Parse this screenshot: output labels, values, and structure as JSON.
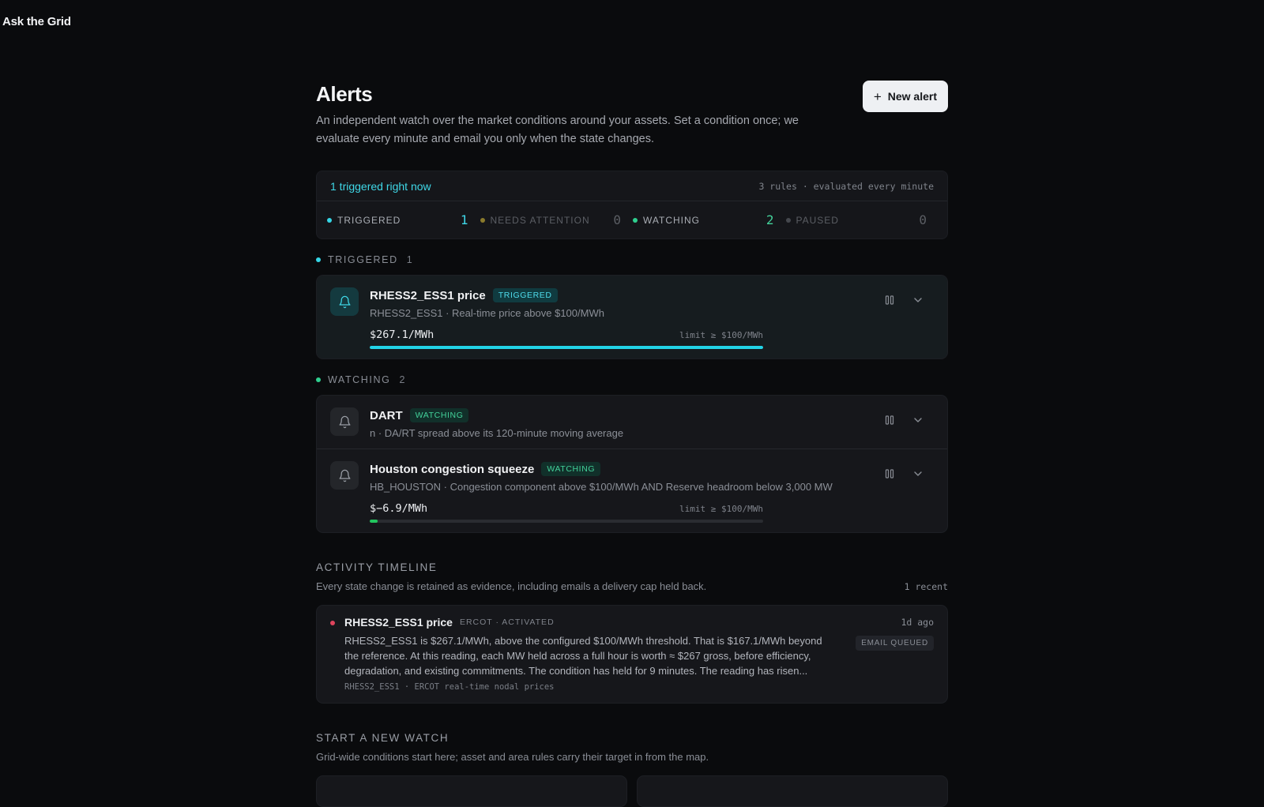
{
  "app": {
    "brand": "Ask the Grid"
  },
  "header": {
    "title": "Alerts",
    "description": "An independent watch over the market conditions around your assets. Set a condition once; we evaluate every minute and email you only when the state changes.",
    "new_alert_label": "New alert"
  },
  "summary": {
    "headline": "1 triggered right now",
    "meta": "3 rules · evaluated every minute",
    "stats": [
      {
        "label": "TRIGGERED",
        "value": "1",
        "color": "#35d6e6",
        "label_color": "#a9adb4",
        "value_color": "#3fd8e8"
      },
      {
        "label": "NEEDS ATTENTION",
        "value": "0",
        "color": "#8a7a2c",
        "label_color": "#5b5e64",
        "value_color": "#5b5e64"
      },
      {
        "label": "WATCHING",
        "value": "2",
        "color": "#2fcf8f",
        "label_color": "#a9adb4",
        "value_color": "#43d19a"
      },
      {
        "label": "PAUSED",
        "value": "0",
        "color": "#45484e",
        "label_color": "#5b5e64",
        "value_color": "#5b5e64"
      }
    ]
  },
  "triggered_section": {
    "label": "TRIGGERED",
    "count": "1",
    "dot_color": "#35d6e6",
    "alerts": [
      {
        "title": "RHESS2_ESS1 price",
        "badge": "TRIGGERED",
        "subtitle": "RHESS2_ESS1 · Real-time price above $100/MWh",
        "value": "$267.1/MWh",
        "limit": "limit ≥ $100/MWh",
        "progress": 1.0,
        "bar_color": "#22d3e6"
      }
    ]
  },
  "watching_section": {
    "label": "WATCHING",
    "count": "2",
    "dot_color": "#2fcf8f",
    "alerts": [
      {
        "title": "DART",
        "badge": "WATCHING",
        "subtitle": "n · DA/RT spread above its 120-minute moving average"
      },
      {
        "title": "Houston congestion squeeze",
        "badge": "WATCHING",
        "subtitle": "HB_HOUSTON · Congestion component above $100/MWh AND Reserve headroom below 3,000 MW",
        "value": "$−6.9/MWh",
        "limit": "limit ≥ $100/MWh",
        "progress": 0.02,
        "bar_color": "#22c55e"
      }
    ]
  },
  "activity": {
    "title": "ACTIVITY TIMELINE",
    "description": "Every state change is retained as evidence, including emails a delivery cap held back.",
    "recent": "1 recent",
    "events": [
      {
        "title": "RHESS2_ESS1 price",
        "meta": "ERCOT · ACTIVATED",
        "text": "RHESS2_ESS1 is $267.1/MWh, above the configured $100/MWh threshold. That is $167.1/MWh beyond the reference. At this reading, each MW held across a full hour is worth ≈ $267 gross, before efficiency, degradation, and existing commitments. The condition has held for 9 minutes. The reading has risen...",
        "source": "RHESS2_ESS1 · ERCOT real-time nodal prices",
        "time": "1d ago",
        "badge": "EMAIL QUEUED"
      }
    ]
  },
  "new_watch": {
    "title": "START A NEW WATCH",
    "description": "Grid-wide conditions start here; asset and area rules carry their target in from the map."
  }
}
